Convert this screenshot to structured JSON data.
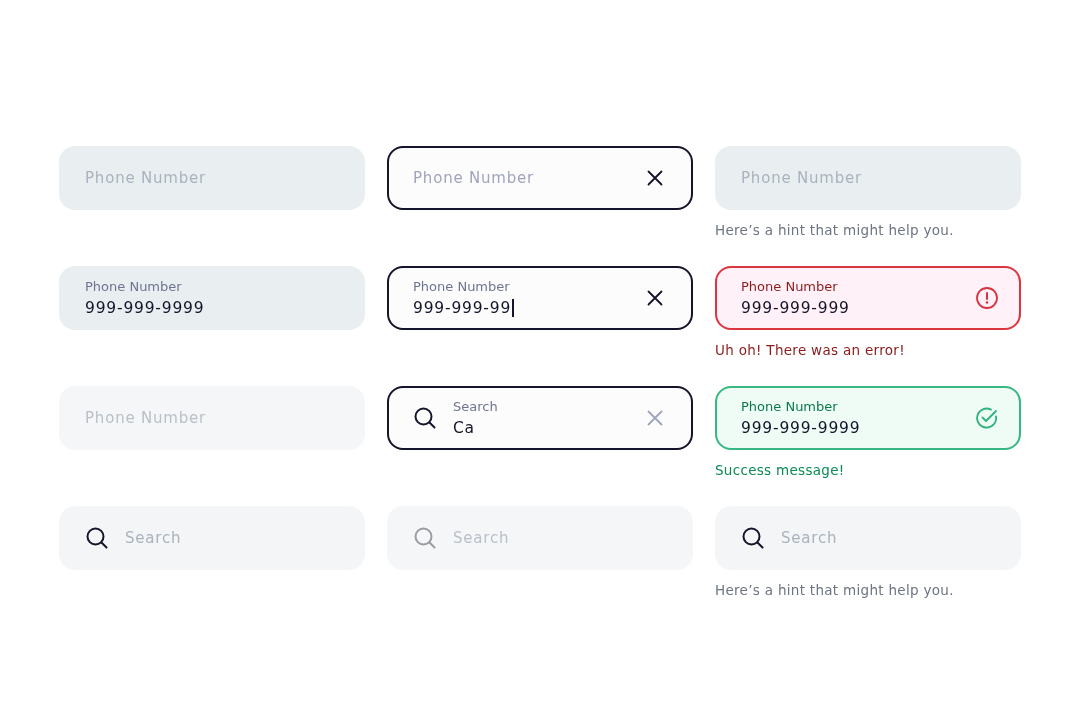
{
  "fields": [
    {
      "kind": "text",
      "focused": false,
      "disabled": false,
      "error": false,
      "success": false,
      "placeholder": "Phone Number"
    },
    {
      "kind": "text",
      "focused": true,
      "disabled": false,
      "error": false,
      "success": false,
      "placeholder": "Phone Number",
      "clear": true
    },
    {
      "kind": "text",
      "focused": false,
      "disabled": false,
      "error": false,
      "success": false,
      "placeholder": "Phone Number",
      "hint": "Here’s a hint that might help you."
    },
    {
      "kind": "text",
      "focused": false,
      "disabled": false,
      "error": false,
      "success": false,
      "label": "Phone Number",
      "value": "999-999-9999"
    },
    {
      "kind": "text",
      "focused": true,
      "disabled": false,
      "error": false,
      "success": false,
      "label": "Phone Number",
      "value": "999-999-99",
      "cursor": true,
      "clear": true
    },
    {
      "kind": "text",
      "focused": false,
      "disabled": false,
      "error": true,
      "success": false,
      "label": "Phone Number",
      "value": "999-999-999",
      "error_message": "Uh oh! There was an error!"
    },
    {
      "kind": "text",
      "focused": false,
      "disabled": true,
      "error": false,
      "success": false,
      "placeholder": "Phone Number"
    },
    {
      "kind": "search",
      "focused": true,
      "disabled": false,
      "error": false,
      "success": false,
      "label": "Search",
      "value": "Ca",
      "clear": true
    },
    {
      "kind": "text",
      "focused": false,
      "disabled": false,
      "error": false,
      "success": true,
      "label": "Phone Number",
      "value": "999-999-9999",
      "success_message": "Success message!"
    },
    {
      "kind": "search",
      "focused": false,
      "disabled": false,
      "error": false,
      "success": false,
      "placeholder": "Search"
    },
    {
      "kind": "search",
      "focused": false,
      "disabled": true,
      "error": false,
      "success": false,
      "placeholder": "Search"
    },
    {
      "kind": "search",
      "focused": false,
      "disabled": false,
      "error": false,
      "success": false,
      "placeholder": "Search",
      "hint": "Here’s a hint that might help you."
    }
  ]
}
